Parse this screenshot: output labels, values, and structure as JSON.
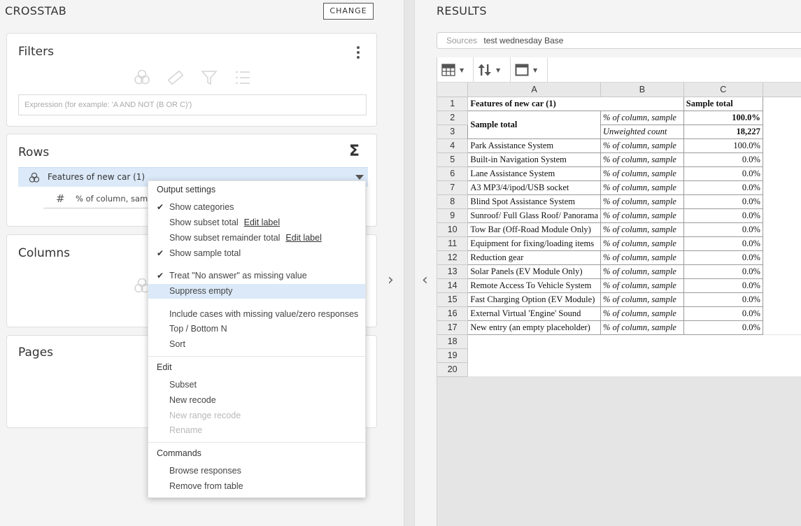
{
  "left_panel": {
    "title": "CROSSTAB",
    "change_label": "CHANGE",
    "filters": {
      "title": "Filters",
      "expression_placeholder": "Expression (for example: 'A AND NOT (B OR C)')"
    },
    "rows": {
      "title": "Rows",
      "item_label": "Features of new car (1)",
      "sub_item_label": "% of column, sample"
    },
    "columns": {
      "title": "Columns"
    },
    "pages": {
      "title": "Pages"
    }
  },
  "context_menu": {
    "output_settings_header": "Output settings",
    "show_categories": "Show categories",
    "show_subset_total": "Show subset total",
    "edit_label_1": "Edit label",
    "show_subset_remainder_total": "Show subset remainder total",
    "edit_label_2": "Edit label",
    "show_sample_total": "Show sample total",
    "treat_no_answer": "Treat \"No answer\" as missing value",
    "suppress_empty": "Suppress empty",
    "include_cases": "Include cases with missing value/zero responses",
    "top_bottom": "Top / Bottom N",
    "sort": "Sort",
    "edit_header": "Edit",
    "subset": "Subset",
    "new_recode": "New recode",
    "new_range_recode": "New range recode",
    "rename": "Rename",
    "commands_header": "Commands",
    "browse_responses": "Browse responses",
    "remove_from_table": "Remove from table"
  },
  "right_panel": {
    "title": "RESULTS",
    "sources_label": "Sources",
    "sources_value": "test wednesday Base",
    "column_headers": [
      "A",
      "B",
      "C"
    ],
    "rows": [
      {
        "n": "1",
        "a": "Features of new car (1)",
        "b": "",
        "c": "Sample total"
      },
      {
        "n": "2",
        "a": "Sample total",
        "b": "% of column, sample",
        "c": "100.0%"
      },
      {
        "n": "3",
        "a": "",
        "b": "Unweighted count",
        "c": "18,227"
      },
      {
        "n": "4",
        "a": "Park Assistance System",
        "b": "% of column, sample",
        "c": "100.0%"
      },
      {
        "n": "5",
        "a": "Built-in Navigation System",
        "b": "% of column, sample",
        "c": "0.0%"
      },
      {
        "n": "6",
        "a": "Lane Assistance System",
        "b": "% of column, sample",
        "c": "0.0%"
      },
      {
        "n": "7",
        "a": "A3 MP3/4/ipod/USB socket",
        "b": "% of column, sample",
        "c": "0.0%"
      },
      {
        "n": "8",
        "a": "Blind Spot Assistance System",
        "b": "% of column, sample",
        "c": "0.0%"
      },
      {
        "n": "9",
        "a": "Sunroof/ Full Glass Roof/ Panorama",
        "b": "% of column, sample",
        "c": "0.0%"
      },
      {
        "n": "10",
        "a": "Tow Bar (Off-Road Module Only)",
        "b": "% of column, sample",
        "c": "0.0%"
      },
      {
        "n": "11",
        "a": "Equipment for fixing/loading items",
        "b": "% of column, sample",
        "c": "0.0%"
      },
      {
        "n": "12",
        "a": "Reduction gear",
        "b": "% of column, sample",
        "c": "0.0%"
      },
      {
        "n": "13",
        "a": "Solar Panels (EV Module Only)",
        "b": "% of column, sample",
        "c": "0.0%"
      },
      {
        "n": "14",
        "a": "Remote Access To Vehicle System",
        "b": "% of column, sample",
        "c": "0.0%"
      },
      {
        "n": "15",
        "a": "Fast Charging Option (EV Module)",
        "b": "% of column, sample",
        "c": "0.0%"
      },
      {
        "n": "16",
        "a": "External Virtual 'Engine' Sound",
        "b": "% of column, sample",
        "c": "0.0%"
      },
      {
        "n": "17",
        "a": "New entry (an empty placeholder)",
        "b": "% of column, sample",
        "c": "0.0%"
      },
      {
        "n": "18"
      },
      {
        "n": "19"
      },
      {
        "n": "20"
      }
    ]
  }
}
